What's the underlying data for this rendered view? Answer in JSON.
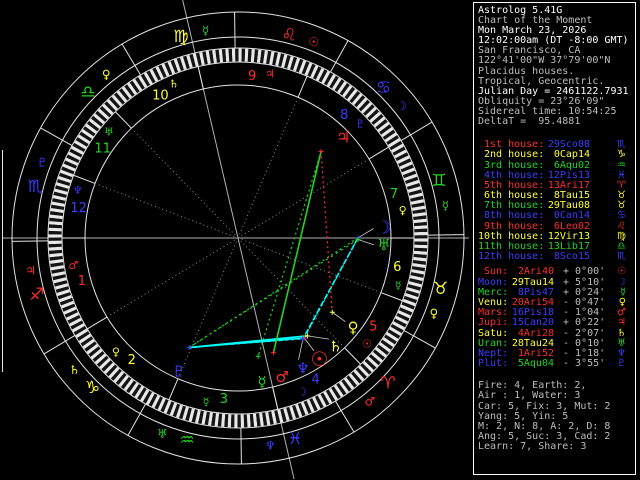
{
  "app": {
    "title": "Astrolog 5.41G"
  },
  "colors": {
    "fire": "#ff2c2c",
    "earth": "#ffff32",
    "air": "#22d422",
    "water": "#3c3cff",
    "red": "#ff2c2c",
    "yellow": "#ffff32",
    "green": "#22d422",
    "blue": "#3c3cff",
    "cyan": "#00ffff",
    "bright": "#ffffff",
    "dim": "#bdbdbd",
    "ring": "#e4e4e4",
    "axis": "#b2b2b2",
    "spoke": "#8c8c8c",
    "stripe_light": "#e8e8e8",
    "stripe_dark": "#141414",
    "connector": "#d0d0d0",
    "bg": "#000000"
  },
  "panel": {
    "header": [
      {
        "text": "Astrolog 5.41G",
        "tone": "bright"
      },
      {
        "text": "Chart of the Moment",
        "tone": "dim"
      },
      {
        "text": "Mon March 23, 2026",
        "tone": "bright"
      },
      {
        "text": "12:02:00am (DT -8:00 GMT)",
        "tone": "bright"
      },
      {
        "text": "San Francisco, CA",
        "tone": "dim"
      },
      {
        "text": "122°41'00\"W 37°79'00\"N",
        "tone": "dim"
      },
      {
        "text": "Placidus houses.",
        "tone": "dim"
      },
      {
        "text": "Tropical, Geocentric.",
        "tone": "dim"
      },
      {
        "text": "Julian Day = 2461122.7931",
        "tone": "bright"
      },
      {
        "text": "Obliquity = 23°26'09\"",
        "tone": "dim"
      },
      {
        "text": "Sidereal time: 10:54:25",
        "tone": "dim"
      },
      {
        "text": "DeltaT =  95.4881",
        "tone": "dim"
      }
    ],
    "houses": [
      {
        "label": " 1st house:",
        "value": "29Sco08",
        "glyph": "♏",
        "lc": "fire",
        "vc": "water"
      },
      {
        "label": " 2nd house:",
        "value": " 0Cap14",
        "glyph": "♑",
        "lc": "earth",
        "vc": "earth"
      },
      {
        "label": " 3rd house:",
        "value": " 6Aqu02",
        "glyph": "♒",
        "lc": "air",
        "vc": "air"
      },
      {
        "label": " 4th house:",
        "value": "12Pis13",
        "glyph": "♓",
        "lc": "water",
        "vc": "water"
      },
      {
        "label": " 5th house:",
        "value": "13Ari17",
        "glyph": "♈",
        "lc": "fire",
        "vc": "fire"
      },
      {
        "label": " 6th house:",
        "value": " 8Tau15",
        "glyph": "♉",
        "lc": "earth",
        "vc": "earth"
      },
      {
        "label": " 7th house:",
        "value": "29Tau08",
        "glyph": "♉",
        "lc": "air",
        "vc": "earth"
      },
      {
        "label": " 8th house:",
        "value": " 0Can14",
        "glyph": "♋",
        "lc": "water",
        "vc": "water"
      },
      {
        "label": " 9th house:",
        "value": " 6Leo02",
        "glyph": "♌",
        "lc": "fire",
        "vc": "fire"
      },
      {
        "label": "10th house:",
        "value": "12Vir13",
        "glyph": "♍",
        "lc": "earth",
        "vc": "earth"
      },
      {
        "label": "11th house:",
        "value": "13Lib17",
        "glyph": "♎",
        "lc": "air",
        "vc": "air"
      },
      {
        "label": "12th house:",
        "value": " 8Sco15",
        "glyph": "♏",
        "lc": "water",
        "vc": "water"
      }
    ],
    "planets": [
      {
        "label": " Sun:",
        "value": " 2Ari40",
        "vel": "+ 0°00'",
        "glyph": "☉",
        "lc": "fire",
        "vc": "fire"
      },
      {
        "label": "Moon:",
        "value": "29Tau14",
        "vel": "+ 5°10'",
        "glyph": "☽",
        "lc": "water",
        "vc": "earth"
      },
      {
        "label": "Merc:",
        "value": " 8Pis47",
        "vel": "+ 0°24'",
        "glyph": "☿",
        "lc": "air",
        "vc": "water"
      },
      {
        "label": "Venu:",
        "value": "20Ari54",
        "vel": "- 0°47'",
        "glyph": "♀",
        "lc": "earth",
        "vc": "fire"
      },
      {
        "label": "Mars:",
        "value": "16Pis18",
        "vel": "- 1°04'",
        "glyph": "♂",
        "lc": "fire",
        "vc": "water"
      },
      {
        "label": "Jupi:",
        "value": "15Can20",
        "vel": "+ 0°22'",
        "glyph": "♃",
        "lc": "fire",
        "vc": "water"
      },
      {
        "label": "Satu:",
        "value": " 4Ari28",
        "vel": "- 2°07'",
        "glyph": "♄",
        "lc": "earth",
        "vc": "fire"
      },
      {
        "label": "Uran:",
        "value": "28Tau24",
        "vel": "- 0°10'",
        "glyph": "♅",
        "lc": "air",
        "vc": "earth"
      },
      {
        "label": "Nept:",
        "value": " 1Ari52",
        "vel": "- 1°18'",
        "glyph": "♆",
        "lc": "water",
        "vc": "fire"
      },
      {
        "label": "Plut:",
        "value": " 5Aqu04",
        "vel": "- 3°55'",
        "glyph": "♇",
        "lc": "water",
        "vc": "air"
      }
    ],
    "summary": [
      "Fire: 4, Earth: 2,",
      "Air : 1, Water: 3",
      "Car: 5, Fix: 3, Mut: 2",
      "Yang: 5, Yin: 5",
      "M: 2, N: 8, A: 2, D: 8",
      "Ang: 5, Suc: 3, Cad: 2",
      "Learn: 7, Share: 3"
    ]
  },
  "wheel": {
    "asc_deg": 239.13,
    "signs": [
      {
        "name": "aries",
        "glyph": "♈",
        "el": "fire",
        "ruler": "♂",
        "ruler_el": "fire"
      },
      {
        "name": "taurus",
        "glyph": "♉",
        "el": "earth",
        "ruler": "♀",
        "ruler_el": "earth"
      },
      {
        "name": "gemini",
        "glyph": "♊",
        "el": "air",
        "ruler": "☿",
        "ruler_el": "air"
      },
      {
        "name": "cancer",
        "glyph": "♋",
        "el": "water",
        "ruler": "☽",
        "ruler_el": "water"
      },
      {
        "name": "leo",
        "glyph": "♌",
        "el": "fire",
        "ruler": "☉",
        "ruler_el": "fire"
      },
      {
        "name": "virgo",
        "glyph": "♍",
        "el": "earth",
        "ruler": "☿",
        "ruler_el": "air"
      },
      {
        "name": "libra",
        "glyph": "♎",
        "el": "air",
        "ruler": "♀",
        "ruler_el": "earth"
      },
      {
        "name": "scorpio",
        "glyph": "♏",
        "el": "water",
        "ruler": "♇",
        "ruler_el": "water"
      },
      {
        "name": "sagittarius",
        "glyph": "♐",
        "el": "fire",
        "ruler": "♃",
        "ruler_el": "fire"
      },
      {
        "name": "capricorn",
        "glyph": "♑",
        "el": "earth",
        "ruler": "♄",
        "ruler_el": "earth"
      },
      {
        "name": "aquarius",
        "glyph": "♒",
        "el": "air",
        "ruler": "♅",
        "ruler_el": "air"
      },
      {
        "name": "pisces",
        "glyph": "♓",
        "el": "water",
        "ruler": "♆",
        "ruler_el": "water"
      }
    ],
    "house_cusps_deg": [
      239.13,
      270.23,
      306.03,
      342.22,
      13.28,
      38.25,
      59.13,
      90.23,
      126.03,
      162.22,
      193.28,
      218.25
    ],
    "house_rulers": [
      "♂",
      "♀",
      "☿",
      "☽",
      "☉",
      "☿",
      "♀",
      "♇",
      "♃",
      "♄",
      "♅",
      "♆"
    ],
    "house_ruler_el": [
      "fire",
      "earth",
      "air",
      "water",
      "fire",
      "air",
      "earth",
      "water",
      "fire",
      "earth",
      "air",
      "water"
    ],
    "planets": [
      {
        "name": "sun",
        "glyph": "☉",
        "el": "fire",
        "lon": 2.67,
        "spread": 0.4,
        "size": 20,
        "line": true
      },
      {
        "name": "moon",
        "glyph": "☽",
        "el": "water",
        "lon": 59.23,
        "spread": 3.9,
        "size": 18,
        "line": true
      },
      {
        "name": "mercury",
        "glyph": "☿",
        "el": "air",
        "lon": 338.78,
        "spread": -0.2,
        "size": 15,
        "line": false
      },
      {
        "name": "venus",
        "glyph": "♀",
        "el": "earth",
        "lon": 20.9,
        "spread": 0.3,
        "size": 15,
        "line": true
      },
      {
        "name": "mars",
        "glyph": "♂",
        "el": "fire",
        "lon": 346.3,
        "spread": 0.4,
        "size": 15,
        "line": false
      },
      {
        "name": "jupiter",
        "glyph": "♃",
        "el": "fire",
        "lon": 105.33,
        "spread": -2.3,
        "size": 16,
        "line": false
      },
      {
        "name": "saturn",
        "glyph": "♄",
        "el": "earth",
        "lon": 4.47,
        "spread": 6.6,
        "size": 15,
        "line": true
      },
      {
        "name": "uranus",
        "glyph": "♅",
        "el": "air",
        "lon": 58.4,
        "spread": -2.1,
        "size": 15,
        "line": true
      },
      {
        "name": "neptune",
        "glyph": "♆",
        "el": "water",
        "lon": 1.87,
        "spread": -6.3,
        "size": 15,
        "line": true
      },
      {
        "name": "pluto",
        "glyph": "♇",
        "el": "water",
        "lon": 305.07,
        "spread": 0.2,
        "size": 15,
        "line": false
      }
    ],
    "aspects": [
      {
        "a": "pluto",
        "b": "saturn",
        "type": "sextile",
        "color": "cyan",
        "w": 1.8,
        "dash": ""
      },
      {
        "a": "pluto",
        "b": "sun",
        "type": "sextile",
        "color": "cyan",
        "w": 1.3,
        "dash": ""
      },
      {
        "a": "pluto",
        "b": "neptune",
        "type": "sextile",
        "color": "cyan",
        "w": 1.0,
        "dash": "4 2"
      },
      {
        "a": "moon",
        "b": "neptune",
        "type": "sextile",
        "color": "cyan",
        "w": 1.6,
        "dash": "6 2"
      },
      {
        "a": "moon",
        "b": "sun",
        "type": "sextile",
        "color": "cyan",
        "w": 1.0,
        "dash": "3 2"
      },
      {
        "a": "jupiter",
        "b": "mars",
        "type": "trine",
        "color": "green",
        "w": 1.6,
        "dash": ""
      },
      {
        "a": "jupiter",
        "b": "mercury",
        "type": "trine",
        "color": "green",
        "w": 1.2,
        "dash": "2 3"
      },
      {
        "a": "moon",
        "b": "pluto",
        "type": "trine",
        "color": "green",
        "w": 1.2,
        "dash": "2 3"
      },
      {
        "a": "uranus",
        "b": "pluto",
        "type": "trine",
        "color": "green",
        "w": 1.2,
        "dash": "2 4"
      },
      {
        "a": "jupiter",
        "b": "venus",
        "type": "square",
        "color": "red",
        "w": 1.2,
        "dash": "2 3"
      }
    ]
  }
}
